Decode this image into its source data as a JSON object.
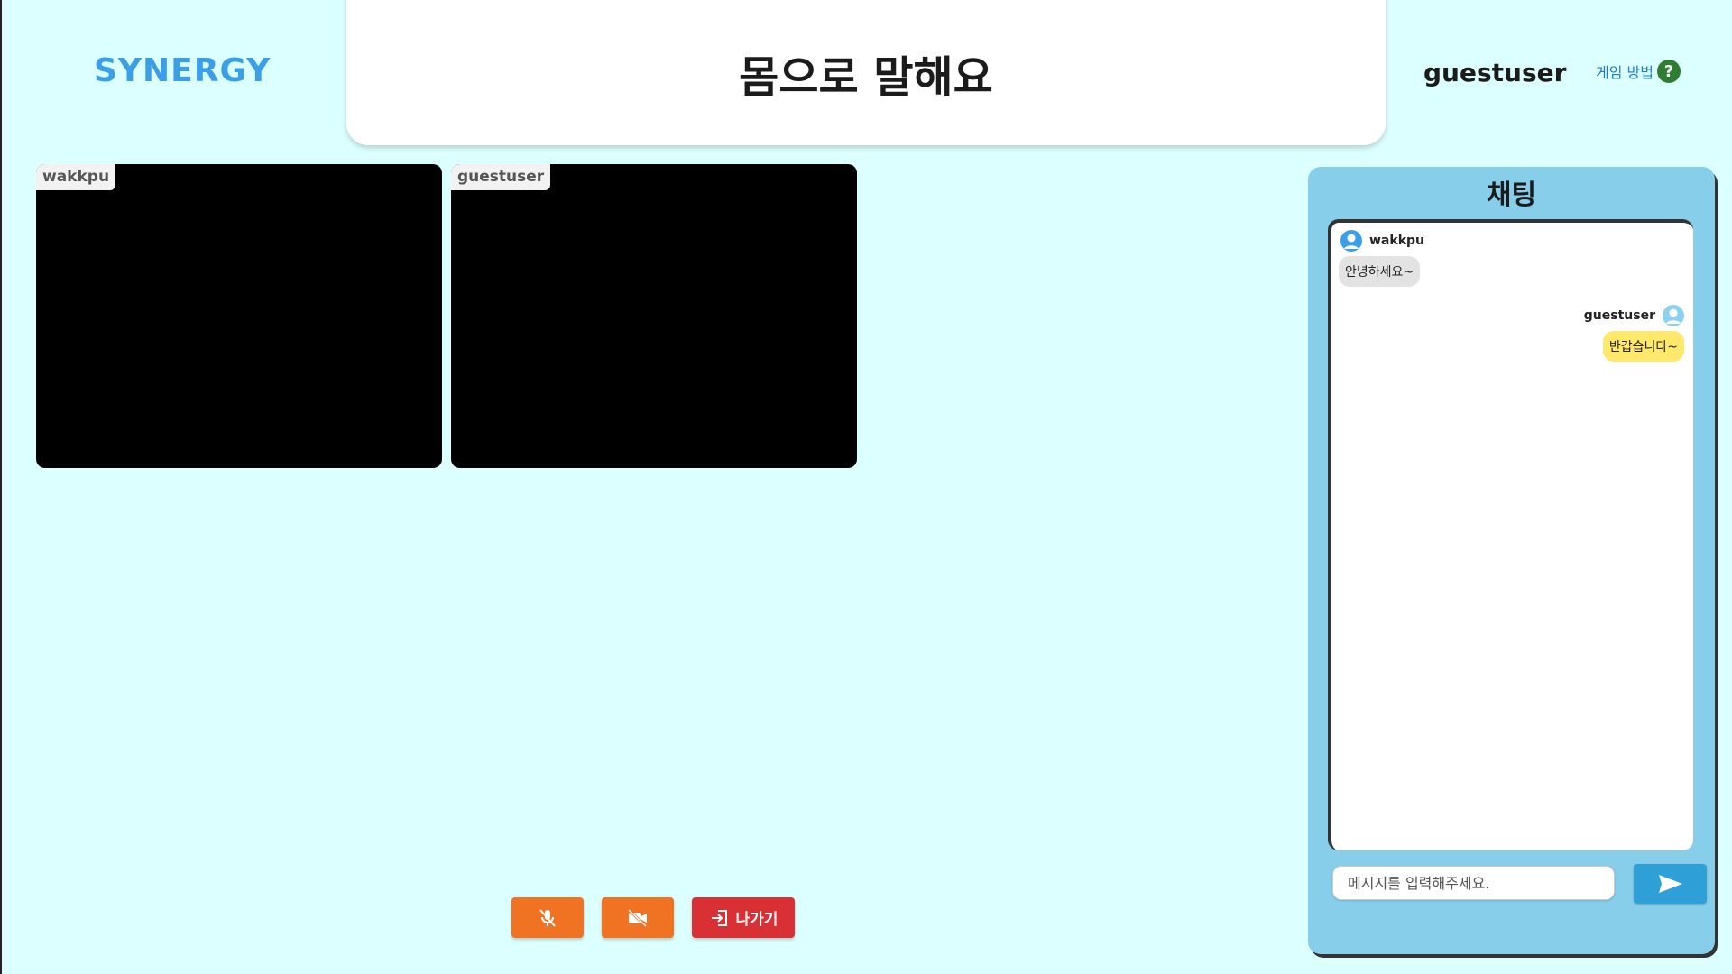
{
  "app": {
    "logo": "SYNERGY",
    "title": "몸으로 말해요",
    "username": "guestuser",
    "help_label": "게임 방법",
    "help_icon": "question-circle-icon"
  },
  "videos": [
    {
      "label": "wakkpu"
    },
    {
      "label": "guestuser"
    }
  ],
  "controls": {
    "mic_icon": "mic-off-icon",
    "camera_icon": "camera-off-icon",
    "leave_icon": "exit-icon",
    "leave_label": "나가기"
  },
  "chat": {
    "title": "채팅",
    "messages": [
      {
        "sender": "wakkpu",
        "text": "안녕하세요~",
        "side": "left"
      },
      {
        "sender": "guestuser",
        "text": "반갑습니다~",
        "side": "right"
      }
    ],
    "input_placeholder": "메시지를 입력해주세요.",
    "send_icon": "send-icon"
  },
  "colors": {
    "background": "#dcffff",
    "accent": "#3a9fe8",
    "chat_panel": "#87ceeb",
    "control_orange": "#f07324",
    "leave_red": "#d93036",
    "bubble_self": "#ffe86a",
    "bubble_other": "#e3e3e3"
  }
}
